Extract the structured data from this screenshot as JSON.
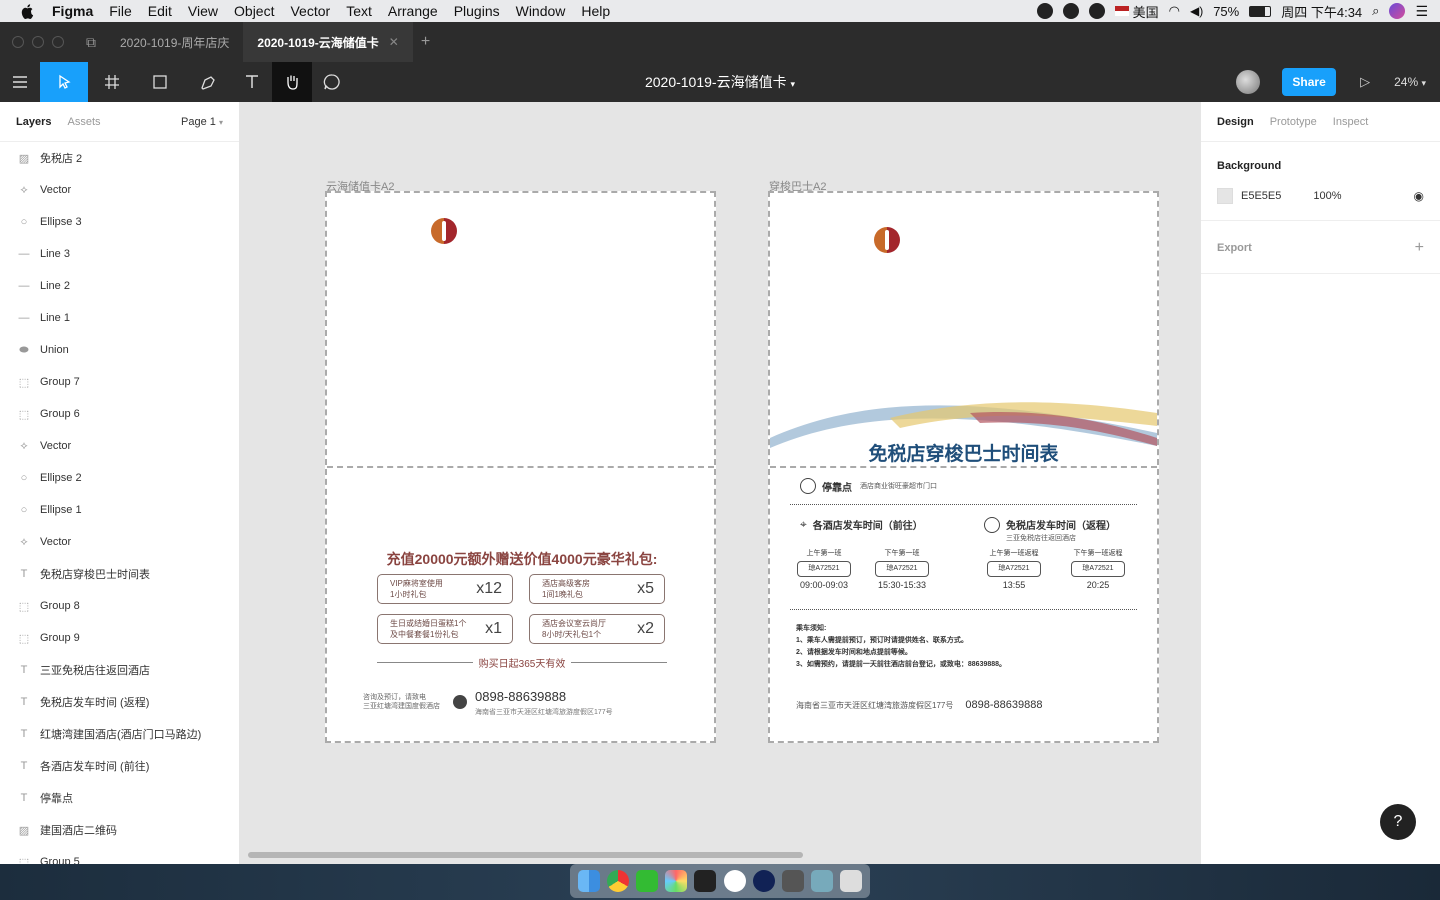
{
  "menubar": {
    "app_name": "Figma",
    "items": [
      "File",
      "Edit",
      "View",
      "Object",
      "Vector",
      "Text",
      "Arrange",
      "Plugins",
      "Window",
      "Help"
    ],
    "input_source": "美国",
    "battery": "75%",
    "clock": "周四 下午4:34"
  },
  "tabs": [
    {
      "label": "2020-1019-周年店庆",
      "active": false
    },
    {
      "label": "2020-1019-云海储值卡",
      "active": true
    }
  ],
  "toolbar": {
    "file_title": "2020-1019-云海储值卡",
    "share_label": "Share",
    "zoom": "24%"
  },
  "left_panel": {
    "tab_layers": "Layers",
    "tab_assets": "Assets",
    "page": "Page 1",
    "layers": [
      {
        "name": "免税店 2",
        "icon": "image-icon"
      },
      {
        "name": "Vector",
        "icon": "vector-icon"
      },
      {
        "name": "Ellipse 3",
        "icon": "ellipse-icon"
      },
      {
        "name": "Line 3",
        "icon": "line-icon"
      },
      {
        "name": "Line 2",
        "icon": "line-icon"
      },
      {
        "name": "Line 1",
        "icon": "line-icon"
      },
      {
        "name": "Union",
        "icon": "union-icon"
      },
      {
        "name": "Group 7",
        "icon": "group-icon"
      },
      {
        "name": "Group 6",
        "icon": "group-icon"
      },
      {
        "name": "Vector",
        "icon": "vector-icon"
      },
      {
        "name": "Ellipse 2",
        "icon": "ellipse-icon"
      },
      {
        "name": "Ellipse 1",
        "icon": "ellipse-icon"
      },
      {
        "name": "Vector",
        "icon": "vector-icon"
      },
      {
        "name": "免税店穿梭巴士时间表",
        "icon": "text-icon"
      },
      {
        "name": "Group 8",
        "icon": "group-icon"
      },
      {
        "name": "Group 9",
        "icon": "group-icon"
      },
      {
        "name": "三亚免税店往返回酒店",
        "icon": "text-icon"
      },
      {
        "name": "免税店发车时间 (返程)",
        "icon": "text-icon"
      },
      {
        "name": "红塘湾建国酒店(酒店门口马路边)",
        "icon": "text-icon"
      },
      {
        "name": "各酒店发车时间 (前往)",
        "icon": "text-icon"
      },
      {
        "name": "停靠点",
        "icon": "text-icon"
      },
      {
        "name": "建国酒店二维码",
        "icon": "image-icon"
      },
      {
        "name": "Group 5",
        "icon": "group-icon"
      }
    ]
  },
  "canvas": {
    "frame1": {
      "label": "云海储值卡A2",
      "promo_title": "充值20000元额外赠送价值4000元豪华礼包:",
      "gifts": [
        {
          "text1": "VIP麻将室使用",
          "text2": "1小时礼包",
          "qty": "x12"
        },
        {
          "text1": "酒店高级客房",
          "text2": "1间1晚礼包",
          "qty": "x5"
        },
        {
          "text1": "生日或结婚日蛋糕1个",
          "text2": "及中餐套餐1份礼包",
          "qty": "x1"
        },
        {
          "text1": "酒店会议室云尚厅",
          "text2": "8小时/天礼包1个",
          "qty": "x2"
        }
      ],
      "validity": "购买日起365天有效",
      "contact_line1": "咨询及预订，请致电",
      "contact_line2": "三亚红塘湾建国度假酒店",
      "phone": "0898-88639888",
      "address": "海南省三亚市天涯区红塘湾旅游度假区177号"
    },
    "frame2": {
      "label": "穿梭巴士A2",
      "title": "免税店穿梭巴士时间表",
      "stop_label": "停靠点",
      "stop_text": "酒店商业街旺豪超市门口",
      "dep_go": "各酒店发车时间（前往）",
      "dep_return": "免税店发车时间（返程）",
      "dep_return_sub": "三亚免税店往返回酒店",
      "schedules": [
        {
          "label": "上午第一班",
          "code": "琼A72521",
          "time": "09:00-09:03"
        },
        {
          "label": "下午第一班",
          "code": "琼A72521",
          "time": "15:30-15:33"
        },
        {
          "label": "上午第一班返程",
          "code": "琼A72521",
          "time": "13:55"
        },
        {
          "label": "下午第一班返程",
          "code": "琼A72521",
          "time": "20:25"
        }
      ],
      "notice_title": "乘车须知:",
      "notice_1": "1、乘车人需提前预订，预订时请提供姓名、联系方式。",
      "notice_2": "2、请根据发车时间和地点提前等候。",
      "notice_3": "3、如需预约，请提前一天前往酒店前台登记，或致电：88639888。",
      "footer_address": "海南省三亚市天涯区红塘湾旅游度假区177号",
      "footer_phone": "0898-88639888"
    }
  },
  "right_panel": {
    "tabs": [
      "Design",
      "Prototype",
      "Inspect"
    ],
    "background_heading": "Background",
    "bg_hex": "E5E5E5",
    "bg_opacity": "100%",
    "export_heading": "Export"
  },
  "colors": {
    "accent": "#18a0fb",
    "canvas_bg": "#e5e5e5",
    "toolbar_bg": "#2c2c2c",
    "bus_title": "#1f4e7a",
    "promo_title": "#8a4440"
  }
}
